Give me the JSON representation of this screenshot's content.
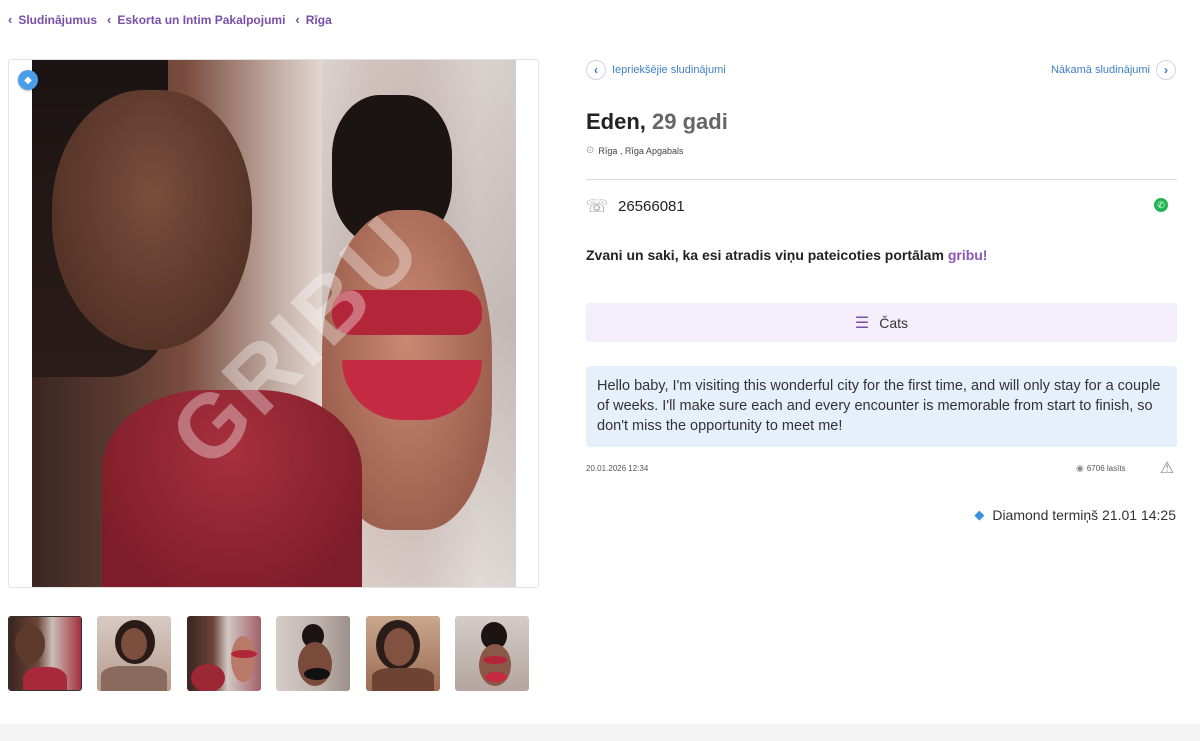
{
  "breadcrumb": [
    {
      "label": "Sludinājumus"
    },
    {
      "label": "Eskorta un Intim Pakalpojumi"
    },
    {
      "label": "Rīga"
    }
  ],
  "photo": {
    "watermark": "GRIBU"
  },
  "nav": {
    "prev_label": "Iepriekšējie sludinājumi",
    "next_label": "Nākamā sludinājumi"
  },
  "listing": {
    "name": "Eden,",
    "age": "29 gadi",
    "city": "Rīga",
    "region": "Rīga Apgabals",
    "phone": "26566081",
    "call_text": "Zvani un saki, ka esi atradis viņu pateicoties portālam",
    "call_brand": "gribu!",
    "chat_label": "Čats",
    "description": "Hello baby, I'm visiting this wonderful city for the first time, and will only stay for a couple of weeks. I'll make sure each and every encounter is memorable from start to finish, so don't miss the opportunity to meet me!",
    "date": "20.01.2026 12:34",
    "views": "6706 lasīts",
    "diamond_term": "Diamond termiņš 21.01 14:25"
  },
  "icons": {
    "chevron": "‹",
    "chevron_right": "›",
    "phone": "☏",
    "whatsapp": "✆",
    "chat": "☰",
    "eye": "◉",
    "warning": "⚠",
    "gem": "◆",
    "pin": "⊙"
  },
  "colors": {
    "accent": "#7a4fa8",
    "link": "#3f7fc6",
    "whatsapp": "#21b451",
    "chat_bg": "#f4eefb",
    "desc_bg": "#e6f0fb"
  }
}
